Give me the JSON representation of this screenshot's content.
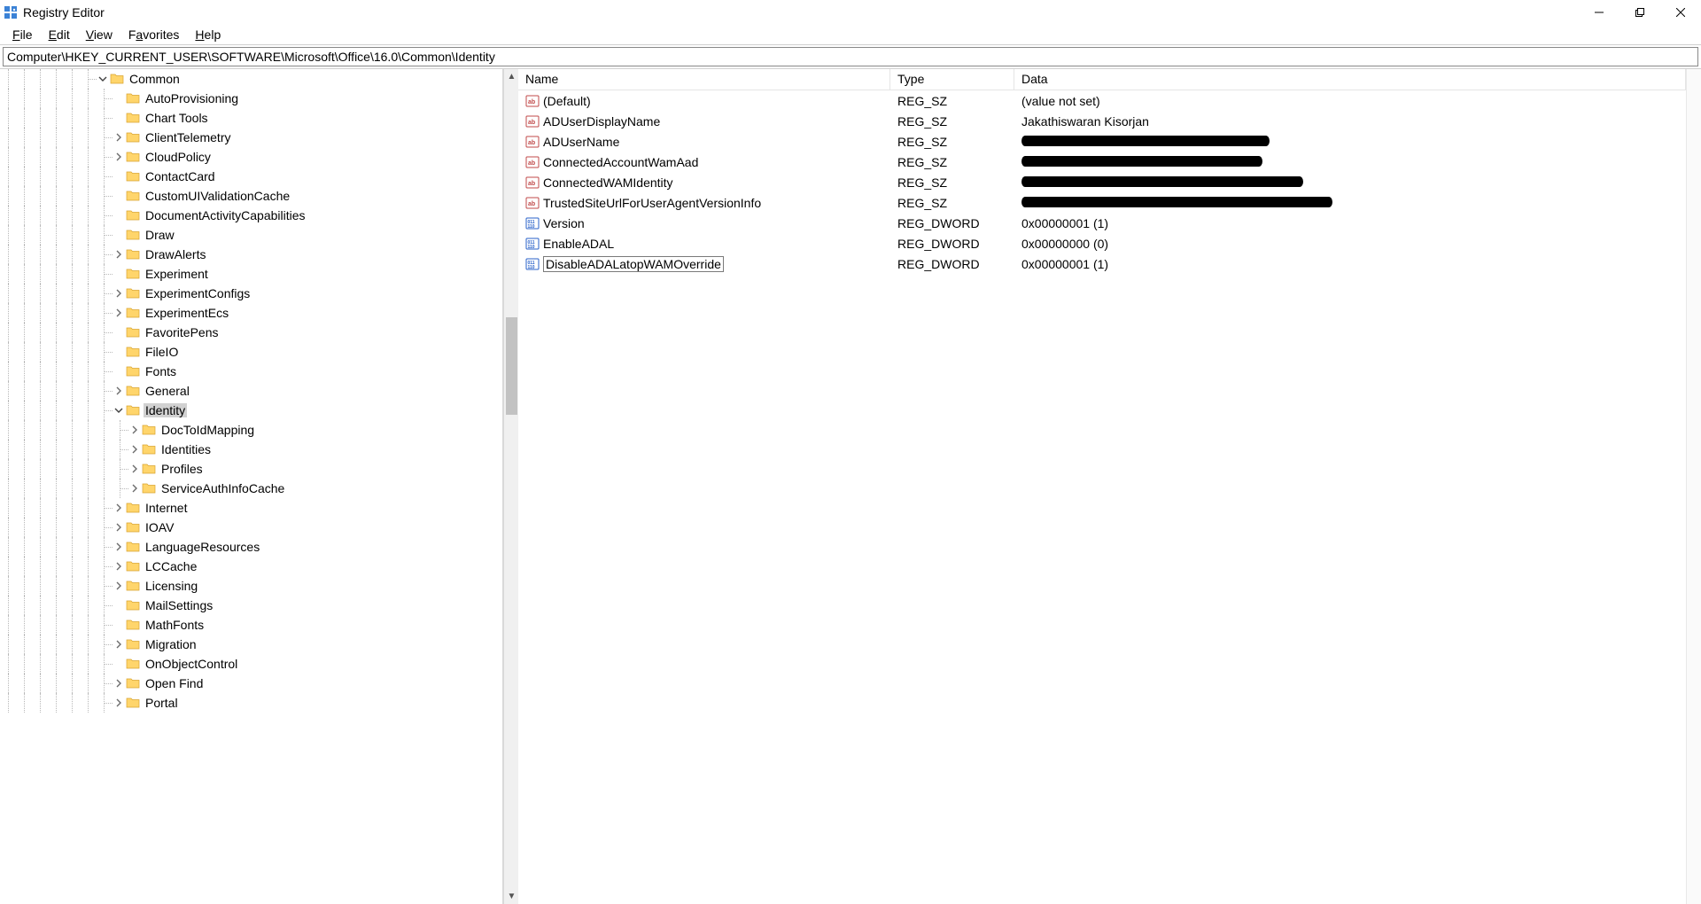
{
  "title": "Registry Editor",
  "menu": {
    "file": "File",
    "edit": "Edit",
    "view": "View",
    "favorites": "Favorites",
    "help": "Help"
  },
  "address": "Computer\\HKEY_CURRENT_USER\\SOFTWARE\\Microsoft\\Office\\16.0\\Common\\Identity",
  "columns": {
    "name": "Name",
    "type": "Type",
    "data": "Data"
  },
  "tree": [
    {
      "label": "Common",
      "depth": 6,
      "expander": "open",
      "selected": false
    },
    {
      "label": "AutoProvisioning",
      "depth": 7,
      "expander": "none"
    },
    {
      "label": "Chart Tools",
      "depth": 7,
      "expander": "none"
    },
    {
      "label": "ClientTelemetry",
      "depth": 7,
      "expander": "closed"
    },
    {
      "label": "CloudPolicy",
      "depth": 7,
      "expander": "closed"
    },
    {
      "label": "ContactCard",
      "depth": 7,
      "expander": "none"
    },
    {
      "label": "CustomUIValidationCache",
      "depth": 7,
      "expander": "none"
    },
    {
      "label": "DocumentActivityCapabilities",
      "depth": 7,
      "expander": "none"
    },
    {
      "label": "Draw",
      "depth": 7,
      "expander": "none"
    },
    {
      "label": "DrawAlerts",
      "depth": 7,
      "expander": "closed"
    },
    {
      "label": "Experiment",
      "depth": 7,
      "expander": "none"
    },
    {
      "label": "ExperimentConfigs",
      "depth": 7,
      "expander": "closed"
    },
    {
      "label": "ExperimentEcs",
      "depth": 7,
      "expander": "closed"
    },
    {
      "label": "FavoritePens",
      "depth": 7,
      "expander": "none"
    },
    {
      "label": "FileIO",
      "depth": 7,
      "expander": "none"
    },
    {
      "label": "Fonts",
      "depth": 7,
      "expander": "none"
    },
    {
      "label": "General",
      "depth": 7,
      "expander": "closed"
    },
    {
      "label": "Identity",
      "depth": 7,
      "expander": "open",
      "selected": true
    },
    {
      "label": "DocToIdMapping",
      "depth": 8,
      "expander": "closed"
    },
    {
      "label": "Identities",
      "depth": 8,
      "expander": "closed"
    },
    {
      "label": "Profiles",
      "depth": 8,
      "expander": "closed"
    },
    {
      "label": "ServiceAuthInfoCache",
      "depth": 8,
      "expander": "closed"
    },
    {
      "label": "Internet",
      "depth": 7,
      "expander": "closed"
    },
    {
      "label": "IOAV",
      "depth": 7,
      "expander": "closed"
    },
    {
      "label": "LanguageResources",
      "depth": 7,
      "expander": "closed"
    },
    {
      "label": "LCCache",
      "depth": 7,
      "expander": "closed"
    },
    {
      "label": "Licensing",
      "depth": 7,
      "expander": "closed"
    },
    {
      "label": "MailSettings",
      "depth": 7,
      "expander": "none"
    },
    {
      "label": "MathFonts",
      "depth": 7,
      "expander": "none"
    },
    {
      "label": "Migration",
      "depth": 7,
      "expander": "closed"
    },
    {
      "label": "OnObjectControl",
      "depth": 7,
      "expander": "none"
    },
    {
      "label": "Open Find",
      "depth": 7,
      "expander": "closed"
    },
    {
      "label": "Portal",
      "depth": 7,
      "expander": "closed"
    }
  ],
  "values": [
    {
      "name": "(Default)",
      "type": "REG_SZ",
      "data": "(value not set)",
      "icon": "str"
    },
    {
      "name": "ADUserDisplayName",
      "type": "REG_SZ",
      "data": "Jakathiswaran Kisorjan",
      "icon": "str"
    },
    {
      "name": "ADUserName",
      "type": "REG_SZ",
      "data": "",
      "icon": "str",
      "redacted": true,
      "redactWidth": 280
    },
    {
      "name": "ConnectedAccountWamAad",
      "type": "REG_SZ",
      "data": "",
      "icon": "str",
      "redacted": true,
      "redactWidth": 272
    },
    {
      "name": "ConnectedWAMIdentity",
      "type": "REG_SZ",
      "data": "",
      "icon": "str",
      "redacted": true,
      "redactWidth": 318
    },
    {
      "name": "TrustedSiteUrlForUserAgentVersionInfo",
      "type": "REG_SZ",
      "data": "",
      "icon": "str",
      "redacted": true,
      "redactWidth": 351
    },
    {
      "name": "Version",
      "type": "REG_DWORD",
      "data": "0x00000001 (1)",
      "icon": "bin"
    },
    {
      "name": "EnableADAL",
      "type": "REG_DWORD",
      "data": "0x00000000 (0)",
      "icon": "bin"
    },
    {
      "name": "DisableADALatopWAMOverride",
      "type": "REG_DWORD",
      "data": "0x00000001 (1)",
      "icon": "bin",
      "rename": true
    }
  ]
}
